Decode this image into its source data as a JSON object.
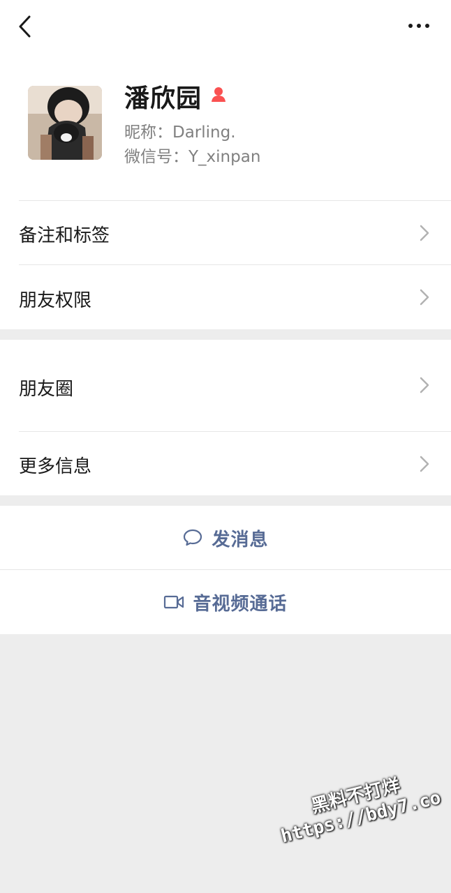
{
  "profile": {
    "name": "潘欣园",
    "nickname": "昵称：Darling.",
    "wechat_id": "微信号：Y_xinpan",
    "gender_icon": "female-icon",
    "gender_color": "#fa5151"
  },
  "menu": {
    "remarks_tags": "备注和标签",
    "friend_permissions": "朋友权限",
    "moments": "朋友圈",
    "more_info": "更多信息"
  },
  "actions": {
    "send_message": "发消息",
    "video_call": "音视频通话"
  },
  "icons": {
    "back": "back-arrow-icon",
    "more": "more-dots-icon",
    "chevron": "chevron-right-icon",
    "message": "chat-bubble-icon",
    "video": "video-camera-icon"
  },
  "colors": {
    "link": "#576b95",
    "background": "#ededed"
  },
  "watermark": {
    "line1": "黑料不打烊",
    "line2": "https://bdy7.co"
  }
}
